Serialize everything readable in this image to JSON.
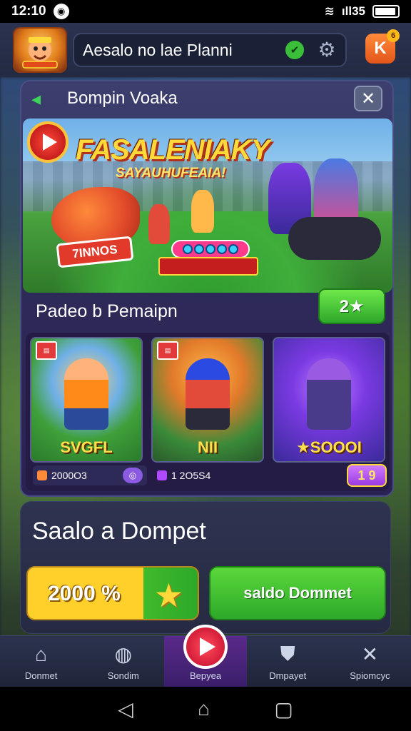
{
  "status_bar": {
    "time": "12:10",
    "notification_icon": "notification-icon",
    "right_text": "ıll35"
  },
  "header": {
    "logo_text": "",
    "search_text": "Aesalo no lae Planni",
    "verify_icon": "✔",
    "gear_icon": "⚙",
    "profile_letter": "K",
    "profile_badge": "6"
  },
  "modal": {
    "title": "Bompin Voaka",
    "close_icon": "✕",
    "back_icon": "◂",
    "banner": {
      "title": "FASALENIAKY",
      "subtitle": "SAYAUHUFEAIA!",
      "tag": "7INNOS"
    },
    "section_title": "Padeo b Pemaipn",
    "count_label": "2★",
    "cards": [
      {
        "label": "SVGFL"
      },
      {
        "label": "NII"
      },
      {
        "label": "★SOOOI"
      }
    ],
    "prices": [
      {
        "value": "2000O3"
      },
      {
        "value": "1 2O5S4"
      },
      {
        "value": "1 9"
      }
    ]
  },
  "deposit": {
    "title": "Saalo a Dompet",
    "amount": "2000 %",
    "deposit_button": "saldo Dommet"
  },
  "bottom_nav": {
    "items": [
      {
        "label": "Donmet",
        "icon": "home-icon"
      },
      {
        "label": "Sondim",
        "icon": "tag-icon"
      },
      {
        "label": "Bepyea",
        "icon": "play-icon"
      },
      {
        "label": "Dmpayet",
        "icon": "shield-icon"
      },
      {
        "label": "Spiomcyc",
        "icon": "tools-icon"
      }
    ]
  },
  "colors": {
    "accent_green": "#2ea82a",
    "accent_yellow": "#ffcf2a",
    "header_bg": "#2b3350",
    "modal_bg": "#2e2a58"
  }
}
